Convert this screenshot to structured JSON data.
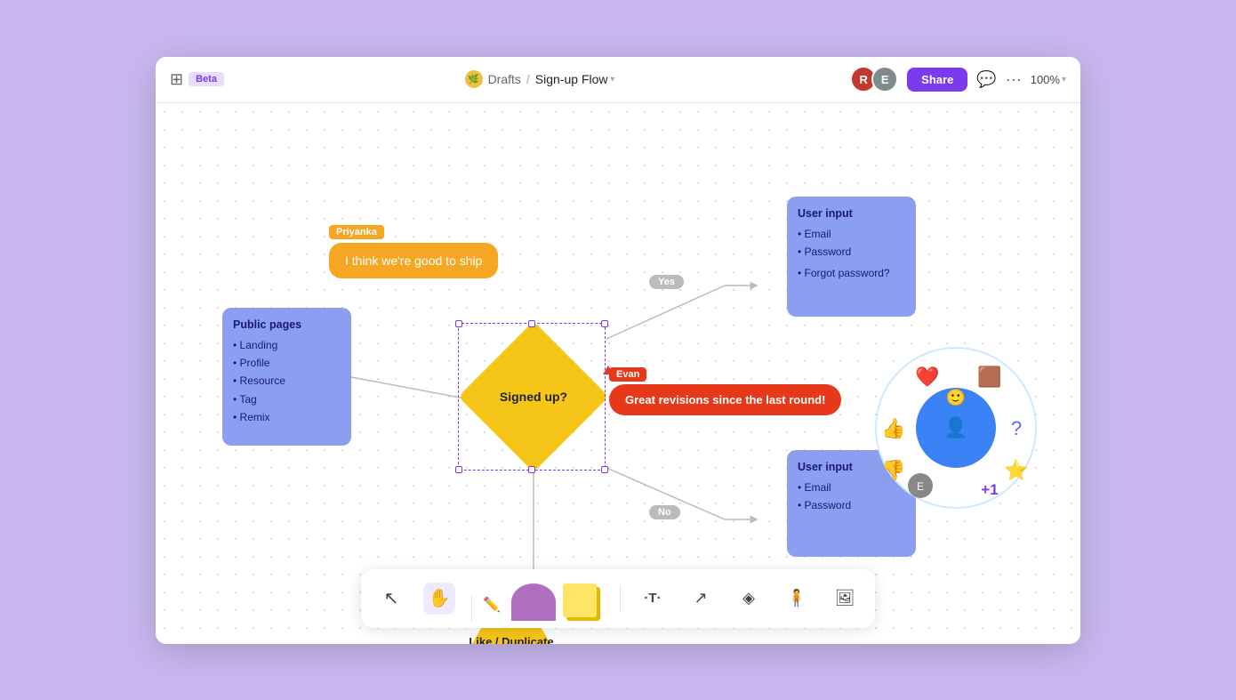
{
  "header": {
    "beta_label": "Beta",
    "breadcrumb_drafts": "Drafts",
    "breadcrumb_sep": "/",
    "breadcrumb_current": "Sign-up Flow",
    "share_label": "Share",
    "zoom_label": "100%"
  },
  "canvas": {
    "public_pages": {
      "title": "Public pages",
      "items": [
        "Landing",
        "Profile",
        "Resource",
        "Tag",
        "Remix"
      ]
    },
    "comment_author": "Priyanka",
    "comment_text": "I think we're good to ship",
    "diamond_label": "Signed up?",
    "yes_label": "Yes",
    "no_label": "No",
    "user_input_top": {
      "title": "User input",
      "items": [
        "Email",
        "Password",
        "Forgot password?"
      ]
    },
    "user_input_bottom": {
      "title": "User input",
      "items": [
        "Email",
        "Password"
      ]
    },
    "evan_author": "Evan",
    "evan_comment": "Great revisions since the last round!",
    "like_dup_label": "Like / Duplicate"
  },
  "toolbar": {
    "cursor_icon": "↖",
    "hand_icon": "✋",
    "pen_icon": "✏",
    "text_icon": "·T·",
    "connector_icon": "↗",
    "diamond_icon": "◈",
    "person_icon": "⬆",
    "image_icon": "⬜"
  }
}
